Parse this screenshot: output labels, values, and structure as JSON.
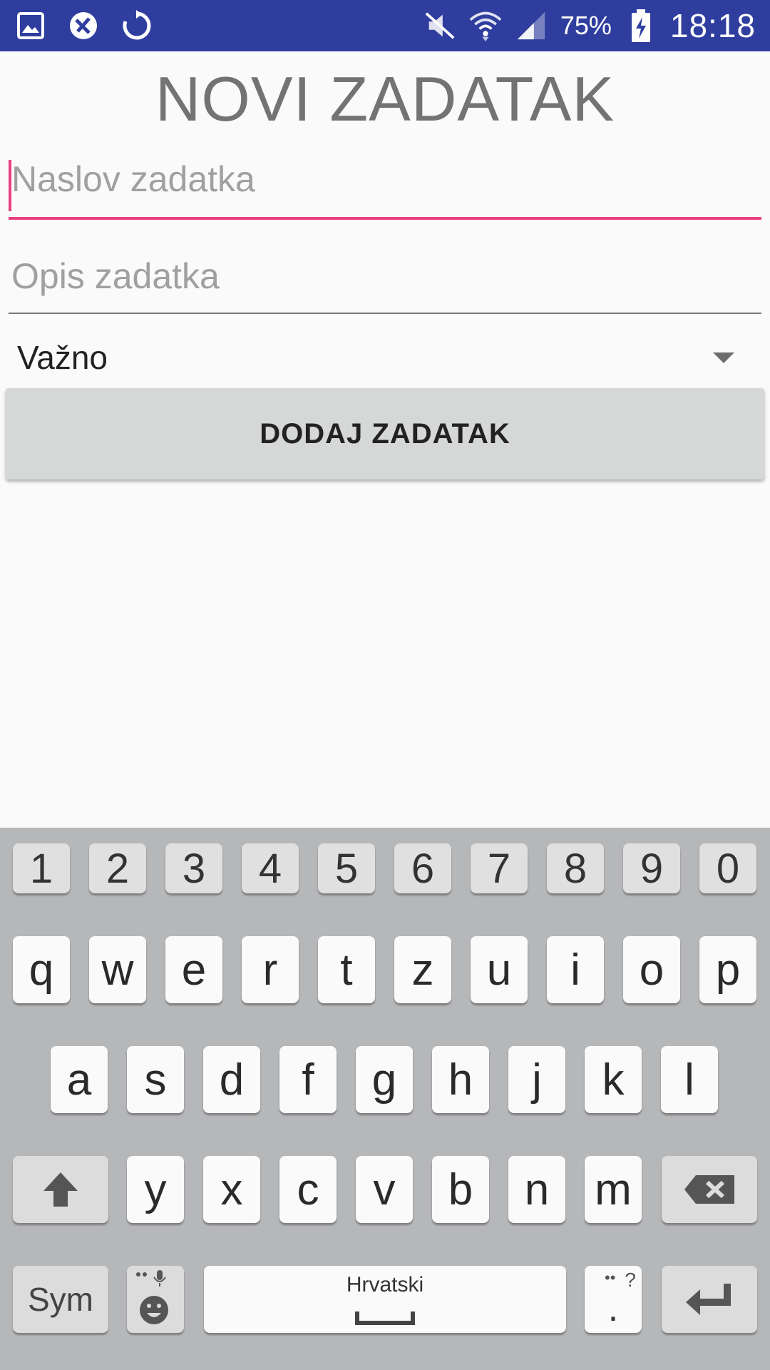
{
  "status_bar": {
    "left_icons": [
      "gallery-icon",
      "no-sim-icon",
      "sync-icon"
    ],
    "right_icons": [
      "mute-icon",
      "wifi-icon",
      "signal-icon"
    ],
    "battery_percent": "75%",
    "time": "18:18",
    "background_color": "#2f3e9e"
  },
  "page": {
    "title": "NOVI ZADATAK",
    "title_input_placeholder": "Naslov zadatka",
    "description_input_placeholder": "Opis zadatka",
    "priority_selected": "Važno",
    "add_button_label": "DODAJ ZADATAK",
    "accent_color": "#e84080"
  },
  "keyboard": {
    "number_row": [
      "1",
      "2",
      "3",
      "4",
      "5",
      "6",
      "7",
      "8",
      "9",
      "0"
    ],
    "row1": [
      "q",
      "w",
      "e",
      "r",
      "t",
      "z",
      "u",
      "i",
      "o",
      "p"
    ],
    "row2": [
      "a",
      "s",
      "d",
      "f",
      "g",
      "h",
      "j",
      "k",
      "l"
    ],
    "row3": [
      "y",
      "x",
      "c",
      "v",
      "b",
      "n",
      "m"
    ],
    "sym_label": "Sym",
    "space_label": "Hrvatski",
    "period_label": ".",
    "period_hint": "?",
    "icons": [
      "shift-icon",
      "backspace-icon",
      "emoji-icon",
      "microphone-icon",
      "enter-icon",
      "spacebar-icon"
    ]
  }
}
